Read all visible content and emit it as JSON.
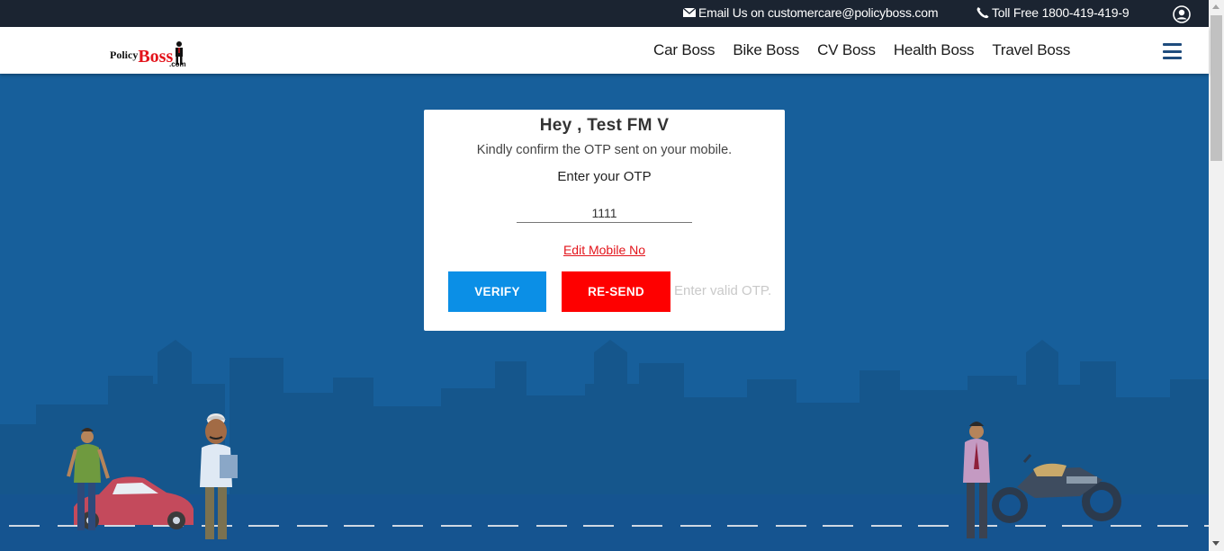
{
  "topbar": {
    "email_text": "Email Us on customercare@policyboss.com",
    "phone_text": "Toll Free 1800-419-419-9",
    "mail_icon": "envelope-icon",
    "phone_icon": "phone-icon",
    "user_icon": "user-circle-icon"
  },
  "header": {
    "logo": {
      "part1": "Policy",
      "part2": "Boss",
      "part3": ".com"
    },
    "nav": [
      "Car Boss",
      "Bike Boss",
      "CV Boss",
      "Health Boss",
      "Travel Boss"
    ],
    "menu_icon": "hamburger-icon"
  },
  "otp_card": {
    "greeting": "Hey , Test FM V",
    "message": "Kindly confirm the OTP sent on your mobile.",
    "label": "Enter your OTP",
    "otp_value": "1111",
    "edit_link": "Edit Mobile No",
    "verify_label": "VERIFY",
    "resend_label": "RE-SEND",
    "error_text": "Enter valid OTP."
  },
  "colors": {
    "topbar_bg": "#1b2431",
    "hero_bg": "#175f9b",
    "verify_bg": "#0b8fe6",
    "resend_bg": "#fe0000",
    "link_red": "#e3141b",
    "nav_menu": "#1f4c7d"
  }
}
